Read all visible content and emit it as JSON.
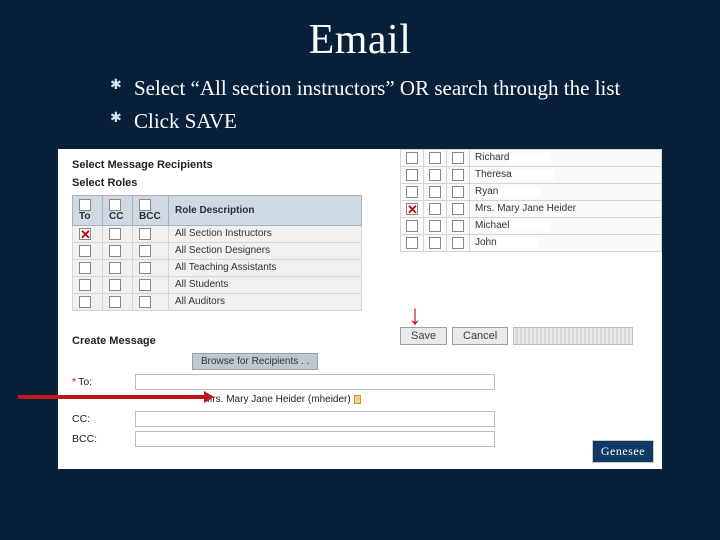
{
  "title": "Email",
  "bullets": [
    "Select “All section instructors” OR search through the list",
    "Click SAVE"
  ],
  "roles": {
    "heading_recipients": "Select Message Recipients",
    "heading_roles": "Select Roles",
    "cols": {
      "to": "To",
      "cc": "CC",
      "bcc": "BCC",
      "desc": "Role Description"
    },
    "rows": [
      {
        "to_marked": true,
        "desc": "All Section Instructors"
      },
      {
        "to_marked": false,
        "desc": "All Section Designers"
      },
      {
        "to_marked": false,
        "desc": "All Teaching Assistants"
      },
      {
        "to_marked": false,
        "desc": "All Students"
      },
      {
        "to_marked": false,
        "desc": "All Auditors"
      }
    ]
  },
  "people": [
    {
      "marked": false,
      "name": "Richard"
    },
    {
      "marked": false,
      "name": "Theresa"
    },
    {
      "marked": false,
      "name": "Ryan"
    },
    {
      "marked": true,
      "name": "Mrs. Mary Jane Heider"
    },
    {
      "marked": false,
      "name": "Michael"
    },
    {
      "marked": false,
      "name": "John"
    }
  ],
  "buttons": {
    "save": "Save",
    "cancel": "Cancel"
  },
  "message": {
    "heading": "Create Message",
    "browse": "Browse for Recipients . .",
    "to_label": "To:",
    "to_value": "Mrs. Mary Jane Heider (mheider)",
    "cc_label": "CC:",
    "bcc_label": "BCC:"
  },
  "logo": "Genesee"
}
